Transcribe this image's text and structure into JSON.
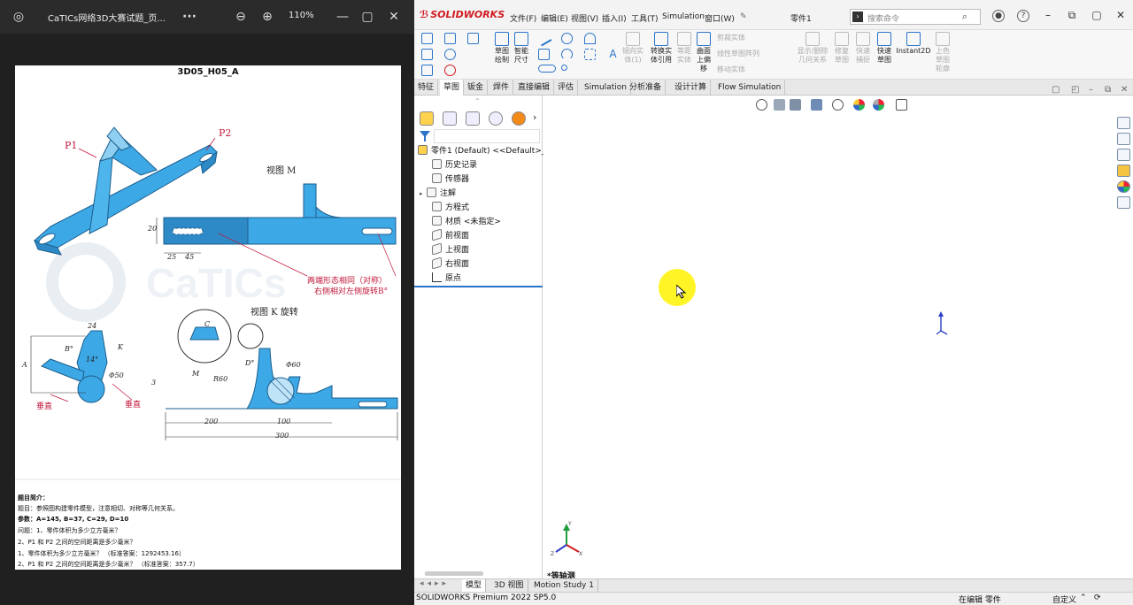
{
  "pdf_viewer": {
    "title": "CaTICs网络3D大赛试题_页...",
    "more_label": "···",
    "zoom": "110%",
    "page": {
      "doc_title": "3D05_H05_A",
      "labels": {
        "p1": "P1",
        "p2": "P2",
        "view_m": "视图 M",
        "view_k": "视图 K 旋转",
        "note_red_1": "两端形态相同（对称）",
        "note_red_2": "右侧相对左侧旋转B°",
        "vertical_1": "垂直",
        "vertical_2": "垂直",
        "m_arrow": "M",
        "k_arrow": "K"
      },
      "dimensions": {
        "d20": "20",
        "d25": "25",
        "d45": "45",
        "d24": "24",
        "d14": "14°",
        "dB": "B°",
        "dA": "A",
        "d50": "Φ50",
        "dR60": "R60",
        "dC": "C",
        "dD": "D°",
        "d60": "Φ60",
        "d200": "200",
        "d100": "100",
        "d300": "300",
        "d3": "3"
      },
      "notes": [
        "题目简介：",
        "题目：参照图构建零件模型，注意相切、对称等几何关系。",
        "参数：A=145, B=37, C=29, D=10",
        "问题：1、零件体积为多少立方毫米？",
        "2、P1 和 P2 之间的空间距离是多少毫米？",
        "1、零件体积为多少立方毫米？          （标准答案：1292453.16）",
        "2、P1 和 P2 之间的空间距离是多少毫米？      （标准答案：357.7）"
      ]
    }
  },
  "solidworks": {
    "logo": "SOLIDWORKS",
    "menus": [
      "文件(F)",
      "编辑(E)",
      "视图(V)",
      "插入(I)",
      "工具(T)",
      "Simulation",
      "窗口(W)"
    ],
    "doc_name": "零件1",
    "search_placeholder": "搜索命令",
    "command_manager": {
      "sketch": "草图\n绘制",
      "smart_dim": "智能\n尺寸",
      "mirror": "镜向实\n体(1)",
      "convert": "转换实\n体引用",
      "offset": "等距\n实体",
      "surface_offset": "曲面\n上偏\n移",
      "trim": "剪裁实体",
      "linear_pattern": "线性草图阵列",
      "move": "移动实体",
      "display_relations": "显示/删除\n几何关系",
      "repair": "修复\n草图",
      "quick_snaps": "快速\n捕捉",
      "rapid_sketch": "快速\n草图",
      "instant2d": "Instant2D",
      "shaded": "上色\n草图\n轮廓"
    },
    "tabs": [
      "特征",
      "草图",
      "钣金",
      "焊件",
      "直接编辑",
      "评估",
      "Simulation",
      "分析准备",
      "设计计算",
      "Flow Simulation"
    ],
    "active_tab": "草图",
    "tree": {
      "root": "零件1 (Default) <<Default>_F",
      "items": [
        "历史记录",
        "传感器",
        "注解",
        "方程式",
        "材质 <未指定>",
        "前视面",
        "上视面",
        "右视面",
        "原点"
      ]
    },
    "view_name": "*等轴测",
    "bottom_tabs": [
      "模型",
      "3D 视图",
      "Motion Study 1"
    ],
    "status": {
      "version": "SOLIDWORKS Premium 2022 SP5.0",
      "editing": "在编辑 零件",
      "custom": "自定义"
    },
    "triad_labels": {
      "x": "X",
      "y": "Y",
      "z": "Z"
    }
  },
  "colors": {
    "accent": "#2a74c9",
    "solidworks_red": "#d11b22",
    "part_blue": "#3da8e6",
    "dim_red": "#c2183a",
    "highlight_yellow": "#fff200"
  }
}
